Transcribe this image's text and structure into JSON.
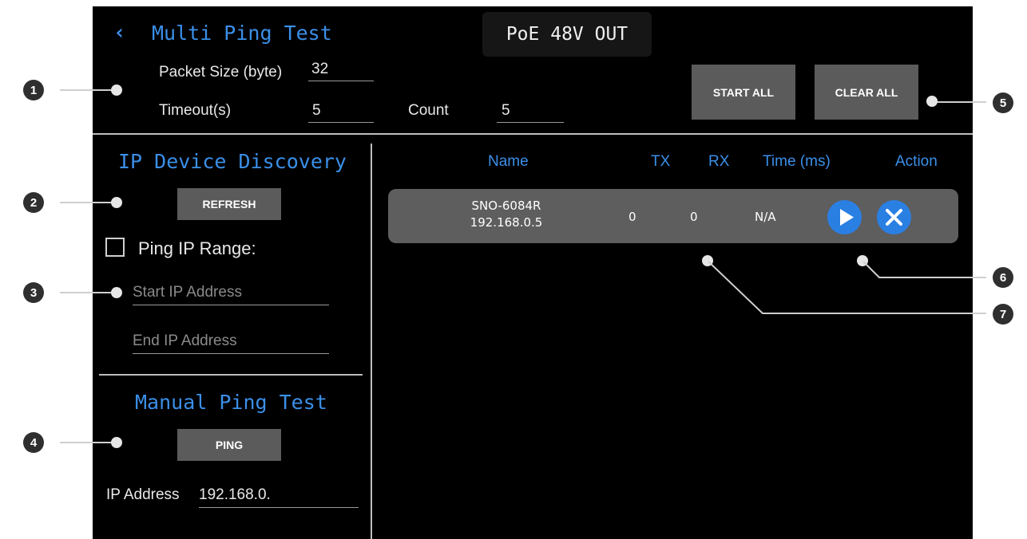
{
  "header": {
    "back_icon": "chevron-left-icon",
    "title": "Multi Ping Test",
    "poe_status": "PoE 48V OUT",
    "packet_size_label": "Packet Size (byte)",
    "packet_size_value": "32",
    "timeout_label": "Timeout(s)",
    "timeout_value": "5",
    "count_label": "Count",
    "count_value": "5",
    "start_all_label": "START ALL",
    "clear_all_label": "CLEAR ALL"
  },
  "discovery": {
    "title": "IP Device Discovery",
    "refresh_label": "REFRESH",
    "ping_range_label": "Ping IP Range:",
    "ping_range_checked": false,
    "start_ip_placeholder": "Start IP Address",
    "end_ip_placeholder": "End IP Address"
  },
  "manual": {
    "title": "Manual Ping Test",
    "ping_label": "PING",
    "ip_label": "IP Address",
    "ip_value": "192.168.0."
  },
  "table": {
    "columns": [
      "Name",
      "TX",
      "RX",
      "Time (ms)",
      "Action"
    ],
    "rows": [
      {
        "name": "SNO-6084R",
        "ip": "192.168.0.5",
        "tx": "0",
        "rx": "0",
        "time": "N/A",
        "actions": [
          "play-icon",
          "close-icon"
        ]
      }
    ]
  },
  "callouts": [
    "1",
    "2",
    "3",
    "4",
    "5",
    "6",
    "7"
  ],
  "colors": {
    "background": "#000000",
    "accent_blue": "#3b8fe8",
    "button_grey": "#5b5b5b",
    "row_grey": "#5e5e5e",
    "callout_dark": "#2f2f2f"
  }
}
